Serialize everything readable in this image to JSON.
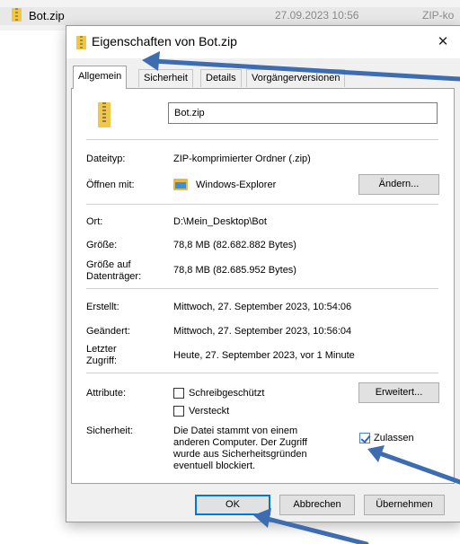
{
  "explorer": {
    "file_name": "Bot.zip",
    "modified": "27.09.2023 10:56",
    "type_trunc": "ZIP-ko"
  },
  "dialog": {
    "title": "Eigenschaften von Bot.zip",
    "close_glyph": "✕",
    "tabs": [
      "Allgemein",
      "Sicherheit",
      "Details",
      "Vorgängerversionen"
    ],
    "file_name_value": "Bot.zip",
    "rows": {
      "type": {
        "label": "Dateityp:",
        "value": "ZIP-komprimierter Ordner (.zip)"
      },
      "opens_with": {
        "label": "Öffnen mit:",
        "value": "Windows-Explorer",
        "button": "Ändern..."
      },
      "location": {
        "label": "Ort:",
        "value": "D:\\Mein_Desktop\\Bot"
      },
      "size": {
        "label": "Größe:",
        "value": "78,8 MB (82.682.882 Bytes)"
      },
      "size_on_disk": {
        "label_line1": "Größe auf",
        "label_line2": "Datenträger:",
        "value": "78,8 MB (82.685.952 Bytes)"
      },
      "created": {
        "label": "Erstellt:",
        "value": "Mittwoch, 27. September 2023, 10:54:06"
      },
      "modified": {
        "label": "Geändert:",
        "value": "Mittwoch, 27. September 2023, 10:56:04"
      },
      "accessed": {
        "label_line1": "Letzter",
        "label_line2": "Zugriff:",
        "value": "Heute, 27. September 2023, vor 1 Minute"
      }
    },
    "attributes": {
      "label": "Attribute:",
      "readonly": {
        "label": "Schreibgeschützt",
        "checked": false
      },
      "hidden": {
        "label": "Versteckt",
        "checked": false
      },
      "advanced_button": "Erweitert..."
    },
    "security": {
      "label": "Sicherheit:",
      "text_lines": [
        "Die Datei stammt von einem",
        "anderen Computer. Der Zugriff",
        "wurde aus Sicherheitsgründen",
        "eventuell blockiert."
      ],
      "unblock": {
        "label": "Zulassen",
        "checked": true
      }
    },
    "buttons": {
      "ok": "OK",
      "cancel": "Abbrechen",
      "apply": "Übernehmen"
    }
  },
  "colors": {
    "annotation_arrow": "#3d6cb0",
    "dialog_bg": "#f0f0f0",
    "focus_border": "#0078d7"
  }
}
